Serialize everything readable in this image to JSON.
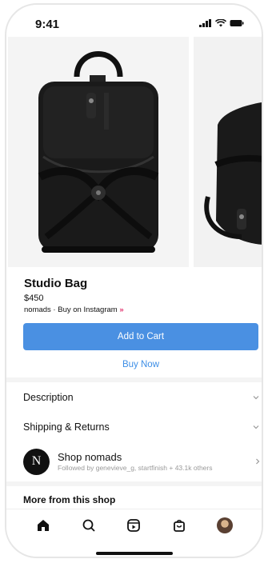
{
  "status_bar": {
    "time": "9:41"
  },
  "product": {
    "title": "Studio Bag",
    "price": "$450",
    "seller_line": "nomads · Buy on Instagram",
    "seller_arrow": "»"
  },
  "actions": {
    "add_to_cart": "Add to Cart",
    "buy_now": "Buy Now"
  },
  "sections": {
    "description": "Description",
    "shipping": "Shipping & Returns"
  },
  "shop": {
    "avatar_letter": "N",
    "name": "Shop nomads",
    "followers": "Followed by genevieve_g, startfinish + 43.1k others"
  },
  "more_title": "More from this shop",
  "colors": {
    "primary_button": "#4a90e2",
    "link": "#3d8ee6",
    "accent_arrow": "#e1306c"
  },
  "tabs": [
    "home-icon",
    "search-icon",
    "reels-icon",
    "shop-icon",
    "profile-avatar"
  ]
}
